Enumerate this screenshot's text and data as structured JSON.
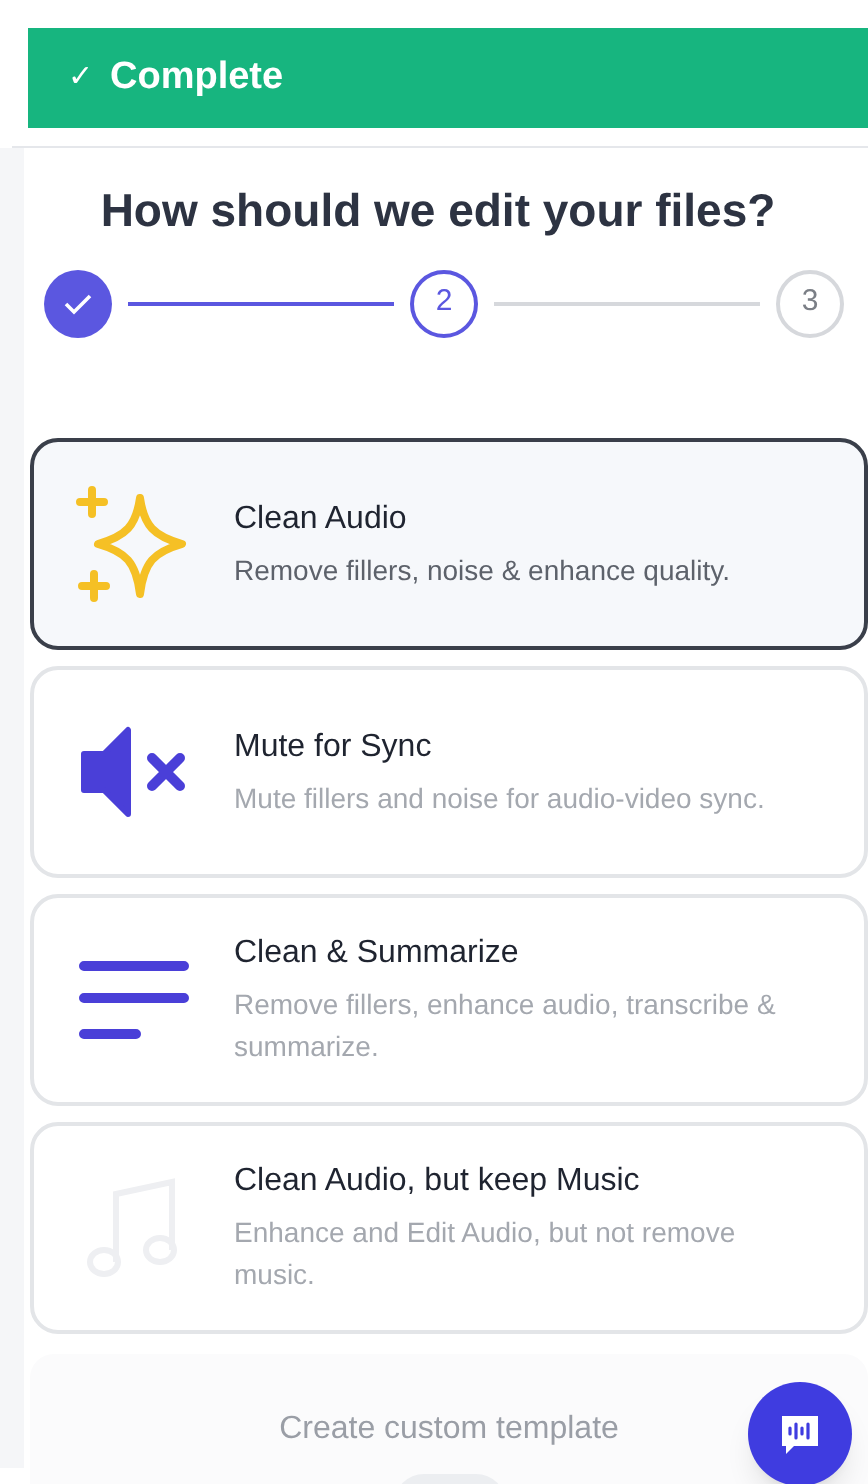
{
  "banner": {
    "icon": "✓",
    "label": "Complete"
  },
  "heading": "How should we edit your files?",
  "steps": [
    {
      "completed": true,
      "selected": false
    },
    {
      "label": "2",
      "completed": false,
      "selected": true
    },
    {
      "label": "3",
      "completed": false,
      "selected": false
    }
  ],
  "options": [
    {
      "kind": "sparkle",
      "title": "Clean Audio",
      "description": "Remove fillers, noise & enhance quality.",
      "selected": true
    },
    {
      "kind": "mute",
      "title": "Mute for Sync",
      "description": "Mute fillers and noise for audio-video sync.",
      "selected": false
    },
    {
      "kind": "lines",
      "title": "Clean & Summarize",
      "description": "Remove fillers, enhance audio, transcribe & summarize.",
      "selected": false
    },
    {
      "kind": "music",
      "title": "Clean Audio, but keep Music",
      "description": "Enhance and Edit Audio, but not remove music.",
      "selected": false
    }
  ],
  "custom_template": {
    "label": "Create custom template"
  }
}
